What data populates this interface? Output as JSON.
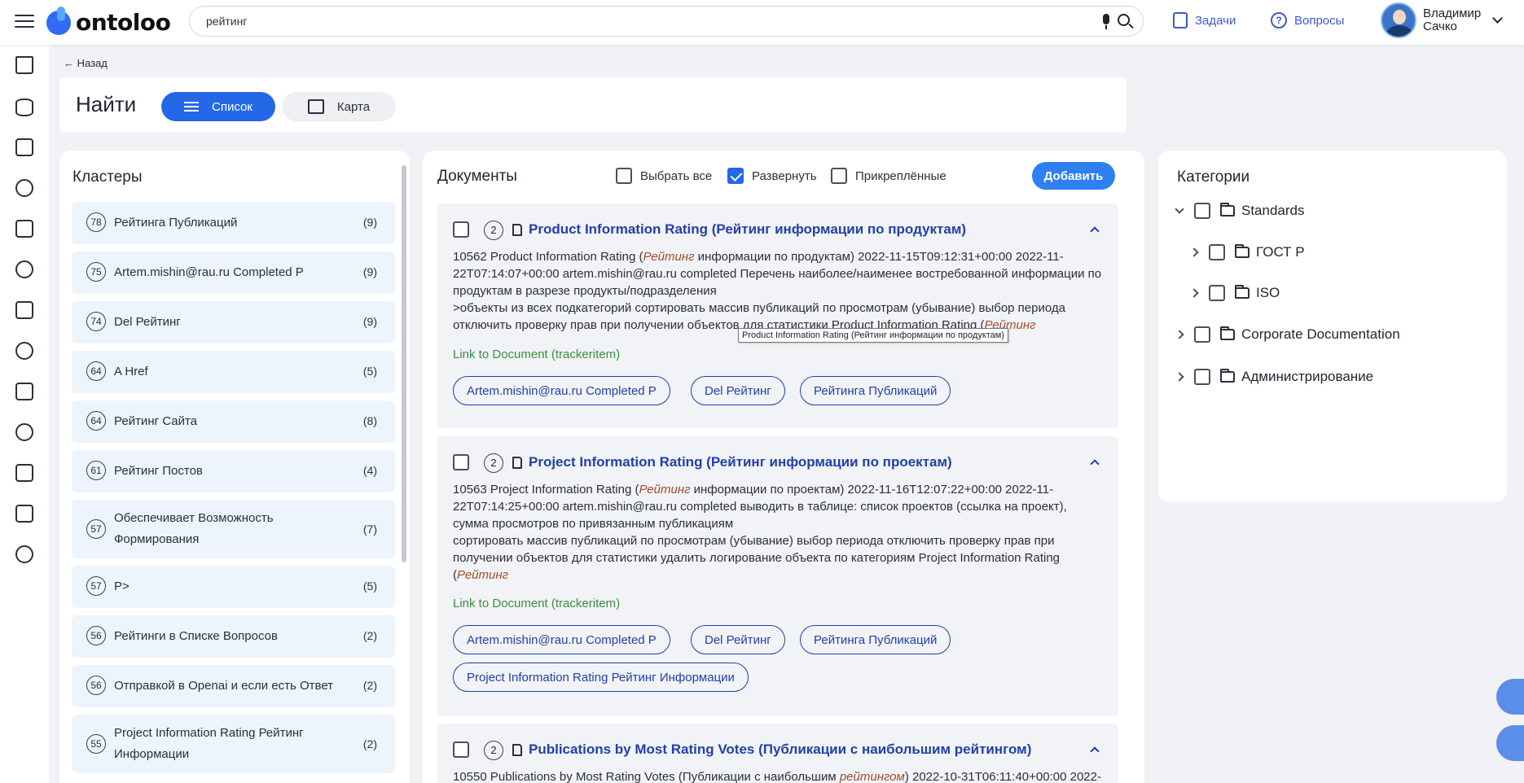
{
  "topbar": {
    "logo_text": "ontoloo",
    "search_value": "рейтинг",
    "tasks_label": "Задачи",
    "questions_label": "Вопросы",
    "user_name_line1": "Владимир",
    "user_name_line2": "Сачко"
  },
  "page": {
    "back_label": "Назад",
    "title": "Найти",
    "view_list_label": "Список",
    "view_map_label": "Карта"
  },
  "clusters": {
    "title": "Кластеры",
    "items": [
      {
        "num": "78",
        "label": "Рейтинга Публикаций",
        "count": "(9)"
      },
      {
        "num": "75",
        "label": "Artem.mishin@rau.ru Completed P",
        "count": "(9)"
      },
      {
        "num": "74",
        "label": "Del Рейтинг",
        "count": "(9)"
      },
      {
        "num": "64",
        "label": "A Href",
        "count": "(5)"
      },
      {
        "num": "64",
        "label": "Рейтинг Сайта",
        "count": "(8)"
      },
      {
        "num": "61",
        "label": "Рейтинг Постов",
        "count": "(4)"
      },
      {
        "num": "57",
        "label": "Обеспечивает Возможность Формирования",
        "count": "(7)"
      },
      {
        "num": "57",
        "label": "P>",
        "count": "(5)"
      },
      {
        "num": "56",
        "label": "Рейтинги в Списке Вопросов",
        "count": "(2)"
      },
      {
        "num": "56",
        "label": "Отправкой в Openai и если есть Ответ",
        "count": "(2)"
      },
      {
        "num": "55",
        "label": "Project Information Rating Рейтинг Информации",
        "count": "(2)"
      }
    ]
  },
  "documents": {
    "title": "Документы",
    "select_all_label": "Выбрать все",
    "expand_label": "Развернуть",
    "pinned_label": "Прикреплённые",
    "add_label": "Добавить",
    "tooltip": "Product Information Rating (Рейтинг информации по продуктам)",
    "items": [
      {
        "num": "2",
        "title": "Product Information Rating (Рейтинг информации по продуктам)",
        "body_1": "10562 Product Information Rating (",
        "body_hl_1": "Рейтинг",
        "body_2": " информации по продуктам) 2022-11-15T09:12:31+00:00 2022-11-22T07:14:07+00:00 artem.mishin@rau.ru completed Перечень наиболее/наименее востребованной информации по продуктам в разрезе продукты/подразделения",
        "body_3": ">объекты из всех подкатегорий сортировать массив публикаций по просмотрам (убывание) выбор периода отключить проверку прав при получении объектов для статистики Product Information Rating (",
        "body_hl_2": "Рейтинг",
        "link": "Link to Document (trackeritem)",
        "tags": [
          "Artem.mishin@rau.ru Completed P",
          "Del Рейтинг",
          "Рейтинга Публикаций"
        ]
      },
      {
        "num": "2",
        "title": "Project Information Rating (Рейтинг информации по проектам)",
        "body_1": "10563 Project Information Rating (",
        "body_hl_1": "Рейтинг",
        "body_2": " информации по проектам) 2022-11-16T12:07:22+00:00 2022-11-22T07:14:25+00:00 artem.mishin@rau.ru completed выводить в таблице: список проектов (ссылка на проект), сумма просмотров по привязанным публикациям",
        "body_3": "сортировать массив публикаций по просмотрам (убывание) выбор периода отключить проверку прав при получении объектов для статистики удалить логирование объекта по категориям Project Information Rating (",
        "body_hl_2": "Рейтинг",
        "link": "Link to Document (trackeritem)",
        "tags": [
          "Artem.mishin@rau.ru Completed P",
          "Del Рейтинг",
          "Рейтинга Публикаций",
          "Project Information Rating Рейтинг Информации"
        ]
      },
      {
        "num": "2",
        "title": "Publications by Most Rating Votes (Публикации с наибольшим рейтингом)",
        "body_1": "10550 Publications by Most Rating Votes (Публикации с наибольшим ",
        "body_hl_1": "рейтингом",
        "body_2": ") 2022-10-31T06:11:40+00:00 2022-"
      }
    ]
  },
  "categories": {
    "title": "Категории",
    "items": [
      {
        "label": "Standards",
        "expanded": true
      },
      {
        "label": "ГОСТ Р"
      },
      {
        "label": "ISO"
      },
      {
        "label": "Corporate Documentation"
      },
      {
        "label": "Администрирование"
      }
    ]
  }
}
